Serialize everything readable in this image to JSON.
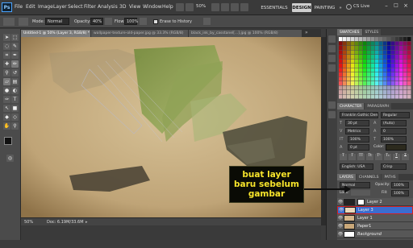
{
  "menubar": {
    "items": [
      "File",
      "Edit",
      "Image",
      "Layer",
      "Select",
      "Filter",
      "Analysis",
      "3D",
      "View",
      "Window",
      "Help"
    ],
    "zoom": "50%",
    "workspaces": [
      "ESSENTIALS",
      "DESIGN",
      "PAINTING"
    ],
    "cslive": "CS Live",
    "active_workspace": "DESIGN"
  },
  "options": {
    "mode_label": "Mode:",
    "mode_value": "Normal",
    "opacity_label": "Opacity:",
    "opacity_value": "40%",
    "flow_label": "Flow:",
    "flow_value": "100%",
    "erase_label": "Erase to History"
  },
  "document_tabs": [
    "Untitled-1 @ 50% (Layer 3, RGB/8) *",
    "wallpaper-texture-old-paper.jpg @ 33.3% (RGB/8)",
    "black_ink_by_casstanel[...].jpg @ 100% (RGB/8)"
  ],
  "status": {
    "zoom": "50%",
    "doc": "Doc: 6.19M/33.6M"
  },
  "panels": {
    "top_tabs": [
      "SWATCHES",
      "STYLES"
    ],
    "char_tabs": [
      "CHARACTER",
      "PARAGRAPH"
    ],
    "font_family": "Franklin Gothic Demi",
    "font_style": "Regular",
    "font_size": "30 pt",
    "leading": "(Auto)",
    "kerning": "Metrics",
    "tracking": "0",
    "vscale": "100%",
    "hscale": "100%",
    "baseline": "0 pt",
    "color_label": "Color:",
    "language": "English: USA",
    "aa": "Crisp",
    "layers_tabs": [
      "LAYERS",
      "CHANNELS",
      "PATHS"
    ],
    "blend_mode": "Normal",
    "opacity_label": "Opacity:",
    "opacity_value": "100%",
    "lock_label": "Lock:",
    "fill_label": "Fill:",
    "fill_value": "100%",
    "layers": [
      {
        "name": "Layer 2",
        "selected": false
      },
      {
        "name": "Layer 3",
        "selected": true
      },
      {
        "name": "Layer 1",
        "selected": false
      },
      {
        "name": "Paper1",
        "selected": false
      },
      {
        "name": "Background",
        "selected": false
      }
    ]
  },
  "annotation": {
    "line1": "buat layer",
    "line2": "baru sebelum",
    "line3": "gambar"
  },
  "colors": {
    "accent": "#3b6dcf",
    "annotation_text": "#f7e42b",
    "arrow": "#111111"
  }
}
